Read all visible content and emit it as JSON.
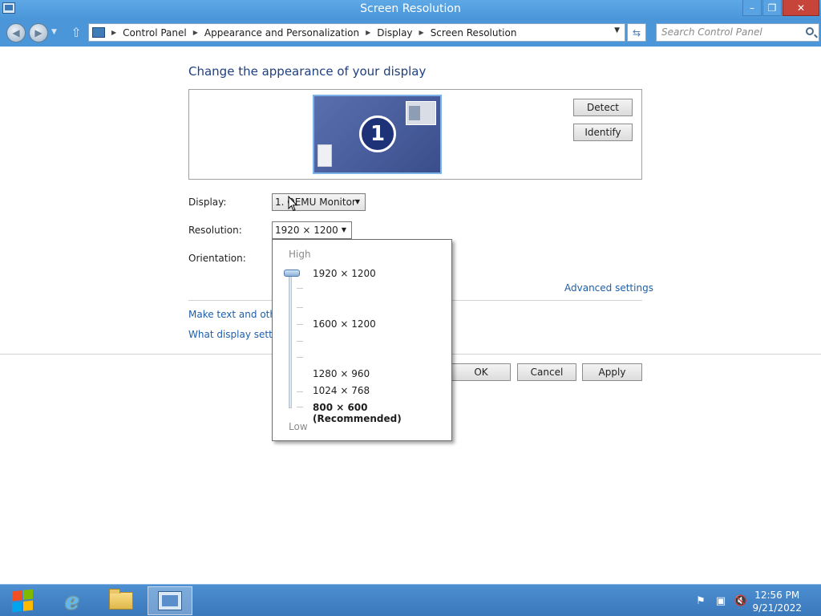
{
  "window": {
    "title": "Screen Resolution",
    "minimize_label": "–",
    "maximize_label": "❐",
    "close_label": "✕"
  },
  "address_bar": {
    "breadcrumbs": [
      "Control Panel",
      "Appearance and Personalization",
      "Display",
      "Screen Resolution"
    ],
    "search_placeholder": "Search Control Panel"
  },
  "content": {
    "heading": "Change the appearance of your display",
    "monitor_number": "1",
    "detect_label": "Detect",
    "identify_label": "Identify",
    "display_label": "Display:",
    "display_value": "1. QEMU Monitor",
    "resolution_label": "Resolution:",
    "resolution_value": "1920 × 1200",
    "orientation_label": "Orientation:",
    "advanced_settings_link": "Advanced settings",
    "link_text_size": "Make text and other",
    "link_display_settings": "What display setting",
    "ok_label": "OK",
    "cancel_label": "Cancel",
    "apply_label": "Apply"
  },
  "resolution_popup": {
    "high_label": "High",
    "low_label": "Low",
    "options": [
      "1920 × 1200",
      "1600 × 1200",
      "1280 × 960",
      "1024 × 768",
      "800 × 600 (Recommended)"
    ],
    "selected": "1920 × 1200"
  },
  "taskbar": {
    "items": [
      "internet-explorer",
      "file-explorer",
      "control-panel"
    ],
    "active_item": "control-panel",
    "clock_time": "12:56 PM",
    "clock_date": "9/21/2022"
  },
  "colors": {
    "titlebar": "#4a96d8",
    "link": "#1e5ea8",
    "heading": "#1e3f82",
    "close_button": "#c7443a"
  }
}
